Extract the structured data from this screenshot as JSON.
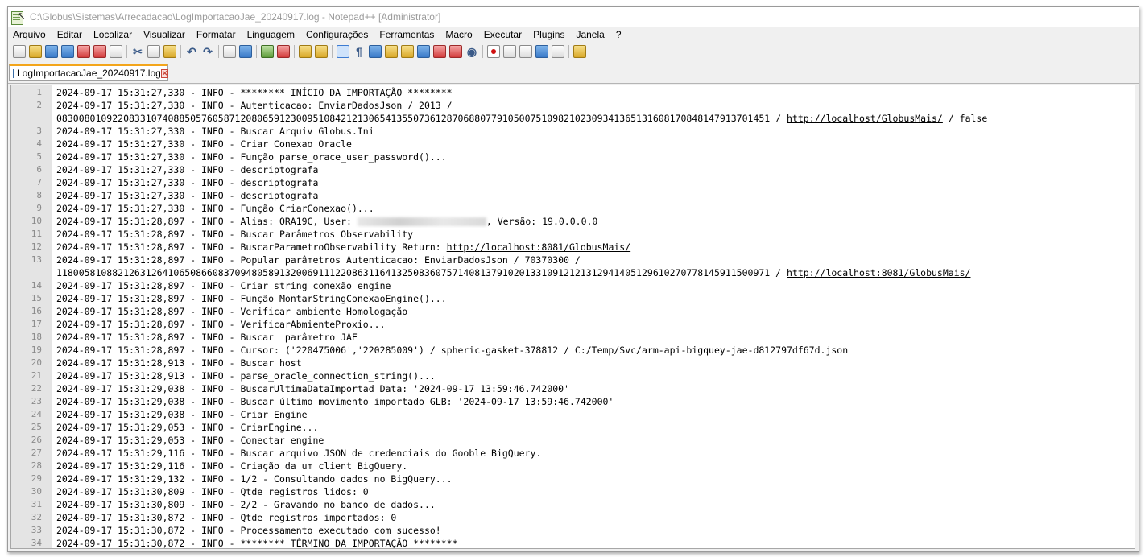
{
  "window": {
    "title": "C:\\Globus\\Sistemas\\Arrecadacao\\LogImportacaoJae_20240917.log - Notepad++ [Administrator]"
  },
  "menu": [
    {
      "label": "Arquivo"
    },
    {
      "label": "Editar"
    },
    {
      "label": "Localizar"
    },
    {
      "label": "Visualizar"
    },
    {
      "label": "Formatar"
    },
    {
      "label": "Linguagem"
    },
    {
      "label": "Configurações"
    },
    {
      "label": "Ferramentas"
    },
    {
      "label": "Macro"
    },
    {
      "label": "Executar"
    },
    {
      "label": "Plugins"
    },
    {
      "label": "Janela"
    },
    {
      "label": "?"
    }
  ],
  "toolbar_icons": [
    "new-file-icon",
    "open-file-icon",
    "save-icon",
    "save-all-icon",
    "close-icon",
    "close-all-icon",
    "print-icon",
    "cut-icon",
    "copy-icon",
    "paste-icon",
    "undo-icon",
    "redo-icon",
    "find-icon",
    "replace-icon",
    "zoom-in-icon",
    "zoom-out-icon",
    "sync-vertical-icon",
    "sync-horizontal-icon",
    "word-wrap-icon",
    "show-all-chars-icon",
    "indent-guide-icon",
    "document-map-icon",
    "function-list-icon",
    "folder-workspace-icon",
    "monitoring-icon",
    "record-macro-icon",
    "stop-record-icon",
    "play-macro-icon",
    "run-macro-multiple-icon",
    "save-macro-icon",
    "clipboard-history-icon"
  ],
  "tab": {
    "label": "LogImportacaoJae_20240917.log"
  },
  "lines": [
    {
      "num": "1",
      "text": "2024-09-17 15:31:27,330 - INFO - ******** INÍCIO DA IMPORTAÇÃO ********"
    },
    {
      "num": "2",
      "text": "2024-09-17 15:31:27,330 - INFO - Autenticacao: EnviarDadosJson / 2013 /"
    },
    {
      "num": "",
      "text": "083008010922083310740885057605871208065912300951084212130654135507361287068807791050075109821023093413651316081708481479137014​51 / ",
      "url": "http://localhost/GlobusMais/",
      "after": " / false"
    },
    {
      "num": "3",
      "text": "2024-09-17 15:31:27,330 - INFO - Buscar Arquiv Globus.Ini"
    },
    {
      "num": "4",
      "text": "2024-09-17 15:31:27,330 - INFO - Criar Conexao Oracle"
    },
    {
      "num": "5",
      "text": "2024-09-17 15:31:27,330 - INFO - Função parse_orace_user_password()..."
    },
    {
      "num": "6",
      "text": "2024-09-17 15:31:27,330 - INFO - descriptografa"
    },
    {
      "num": "7",
      "text": "2024-09-17 15:31:27,330 - INFO - descriptografa"
    },
    {
      "num": "8",
      "text": "2024-09-17 15:31:27,330 - INFO - descriptografa"
    },
    {
      "num": "9",
      "text": "2024-09-17 15:31:27,330 - INFO - Função CriarConexao()..."
    },
    {
      "num": "10",
      "text": "2024-09-17 15:31:28,897 - INFO - Alias: ORA19C, User: ",
      "redacted": true,
      "after": ", Versão: 19.0.0.0.0"
    },
    {
      "num": "11",
      "text": "2024-09-17 15:31:28,897 - INFO - Buscar Parâmetros Observability"
    },
    {
      "num": "12",
      "text": "2024-09-17 15:31:28,897 - INFO - BuscarParametroObservability Return: ",
      "url": "http://localhost:8081/GlobusMais/"
    },
    {
      "num": "13",
      "text": "2024-09-17 15:31:28,897 - INFO - Popular parâmetros Autenticacao: EnviarDadosJson / 70370300 /"
    },
    {
      "num": "",
      "text": "118005810882126312641065086608370948058913200691112208631164132508360757140813791020133109121213129414051296102707781459115009​71 / ",
      "url": "http://localhost:8081/GlobusMais/"
    },
    {
      "num": "14",
      "text": "2024-09-17 15:31:28,897 - INFO - Criar string conexão engine"
    },
    {
      "num": "15",
      "text": "2024-09-17 15:31:28,897 - INFO - Função MontarStringConexaoEngine()..."
    },
    {
      "num": "16",
      "text": "2024-09-17 15:31:28,897 - INFO - Verificar ambiente Homologação"
    },
    {
      "num": "17",
      "text": "2024-09-17 15:31:28,897 - INFO - VerificarAbmienteProxio..."
    },
    {
      "num": "18",
      "text": "2024-09-17 15:31:28,897 - INFO - Buscar  parâmetro JAE"
    },
    {
      "num": "19",
      "text": "2024-09-17 15:31:28,897 - INFO - Cursor: ('220475006','220285009') / spheric-gasket-378812 / C:/Temp/Svc/arm-api-bigquey-jae-d812797df67d.json"
    },
    {
      "num": "20",
      "text": "2024-09-17 15:31:28,913 - INFO - Buscar host"
    },
    {
      "num": "21",
      "text": "2024-09-17 15:31:28,913 - INFO - parse_oracle_connection_string()..."
    },
    {
      "num": "22",
      "text": "2024-09-17 15:31:29,038 - INFO - BuscarUltimaDataImportad Data: '2024-09-17 13:59:46.742000'"
    },
    {
      "num": "23",
      "text": "2024-09-17 15:31:29,038 - INFO - Buscar último movimento importado GLB: '2024-09-17 13:59:46.742000'"
    },
    {
      "num": "24",
      "text": "2024-09-17 15:31:29,038 - INFO - Criar Engine"
    },
    {
      "num": "25",
      "text": "2024-09-17 15:31:29,053 - INFO - CriarEngine..."
    },
    {
      "num": "26",
      "text": "2024-09-17 15:31:29,053 - INFO - Conectar engine"
    },
    {
      "num": "27",
      "text": "2024-09-17 15:31:29,116 - INFO - Buscar arquivo JSON de credenciais do Gooble BigQuery."
    },
    {
      "num": "28",
      "text": "2024-09-17 15:31:29,116 - INFO - Criação da um client BigQuery."
    },
    {
      "num": "29",
      "text": "2024-09-17 15:31:29,132 - INFO - 1/2 - Consultando dados no BigQuery..."
    },
    {
      "num": "30",
      "text": "2024-09-17 15:31:30,809 - INFO - Qtde registros lidos: 0"
    },
    {
      "num": "31",
      "text": "2024-09-17 15:31:30,809 - INFO - 2/2 - Gravando no banco de dados..."
    },
    {
      "num": "32",
      "text": "2024-09-17 15:31:30,872 - INFO - Qtde registros importados: 0"
    },
    {
      "num": "33",
      "text": "2024-09-17 15:31:30,872 - INFO - Processamento executado com sucesso!"
    },
    {
      "num": "34",
      "text": "2024-09-17 15:31:30,872 - INFO - ******** TÉRMINO DA IMPORTAÇÃO ********"
    }
  ]
}
